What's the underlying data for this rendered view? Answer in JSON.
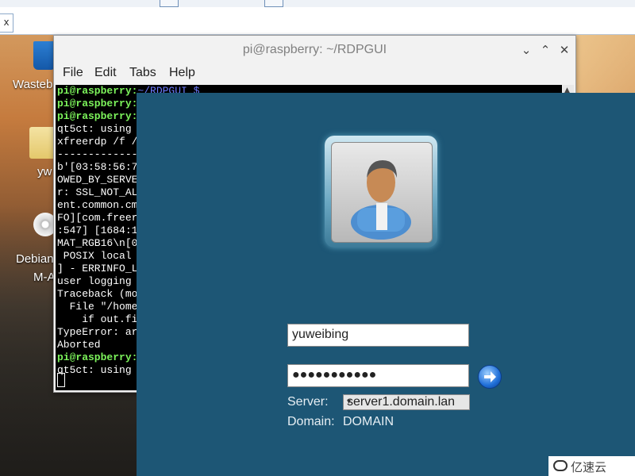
{
  "desktop": {
    "icons": [
      {
        "label": "Wasteb",
        "icon": "trash-icon"
      },
      {
        "label": "yw",
        "icon": "folder-icon"
      },
      {
        "label": "Debian",
        "label2": "M-A",
        "icon": "disc-icon"
      }
    ]
  },
  "top_strip": {
    "tab_close": "x"
  },
  "terminal": {
    "title": "pi@raspberry: ~/RDPGUI",
    "menu": [
      "File",
      "Edit",
      "Tabs",
      "Help"
    ],
    "lines": [
      {
        "prompt": "pi@raspberry:",
        "path": "~/RDPGUI $",
        "text": ""
      },
      {
        "prompt": "pi@raspberry:",
        "path": "",
        "text": ""
      },
      {
        "prompt": "pi@raspberry:",
        "path": "",
        "text": ""
      },
      {
        "prompt": "",
        "path": "",
        "text": "qt5ct: using"
      },
      {
        "prompt": "",
        "path": "",
        "text": "xfreerdp /f /"
      },
      {
        "prompt": "",
        "path": "",
        "text": "-------------"
      },
      {
        "prompt": "",
        "path": "",
        "text": "b'[03:58:56:7"
      },
      {
        "prompt": "",
        "path": "",
        "text": "OWED_BY_SERVE"
      },
      {
        "prompt": "",
        "path": "",
        "text": "r: SSL_NOT_AL"
      },
      {
        "prompt": "",
        "path": "",
        "text": "ent.common.cm"
      },
      {
        "prompt": "",
        "path": "",
        "text": "FO][com.freer"
      },
      {
        "prompt": "",
        "path": "",
        "text": ":547] [1684:1"
      },
      {
        "prompt": "",
        "path": "",
        "text": "MAT_RGB16\\n[0"
      },
      {
        "prompt": "",
        "path": "",
        "text": " POSIX local"
      },
      {
        "prompt": "",
        "path": "",
        "text": "] - ERRINFO_L"
      },
      {
        "prompt": "",
        "path": "",
        "text": "user logging"
      },
      {
        "prompt": "",
        "path": "",
        "text": "Traceback (mo"
      },
      {
        "prompt": "",
        "path": "",
        "text": "  File \"/home"
      },
      {
        "prompt": "",
        "path": "",
        "text": "    if out.fi"
      },
      {
        "prompt": "",
        "path": "",
        "text": "TypeError: ar"
      },
      {
        "prompt": "",
        "path": "",
        "text": "Aborted"
      },
      {
        "prompt": "pi@raspberry:",
        "path": "",
        "text": ""
      },
      {
        "prompt": "",
        "path": "",
        "text": "qt5ct: using"
      }
    ]
  },
  "login": {
    "username": "yuweibing",
    "password_mask": "●●●●●●●●●●●",
    "server_label": "Server:",
    "server_value": "server1.domain.lan",
    "domain_label": "Domain:",
    "domain_value": "DOMAIN"
  },
  "watermark": {
    "text": "亿速云"
  }
}
